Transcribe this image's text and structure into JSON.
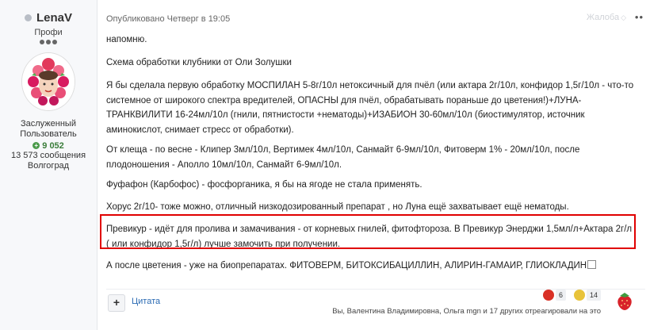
{
  "author": {
    "name": "LenaV",
    "rank": "Профи",
    "title": "Заслуженный Пользователь",
    "reputation": "9 052",
    "posts": "13 573 сообщения",
    "city": "Волгоград"
  },
  "post": {
    "published": "Опубликовано Четверг в 19:05",
    "share_label": "Жалоба",
    "share_count": "◇",
    "more": "••",
    "paragraphs": [
      "напомню.",
      "Схема обработки клубники от Оли Золушки",
      "Я бы сделала первую обработку МОСПИЛАН 5-8г/10л нетоксичный для пчёл (или актара 2г/10л, конфидор 1,5г/10л - что-то системное от широкого спектра вредителей, ОПАСНЫ для пчёл, обрабатывать пораньше до цветения!)+ЛУНА-ТРАНКВИЛИТИ 16-24мл/10л (гнили, пятнистости +нематоды)+ИЗАБИОН 30-60мл/10л (биостимулятор, источник аминокислот, снимает стресс от обработки).",
      "От клеща - по весне - Клипер 3мл/10л, Вертимек 4мл/10л, Санмайт 6-9мл/10л, Фитоверм 1% - 20мл/10л,  после плодоношения - Аполло 10мл/10л, Санмайт 6-9мл/10л.",
      "Фуфафон (Карбофос) - фосфорганика,  я бы на ягоде не стала применять.",
      "Хорус 2г/10- тоже можно, отличный низкодозированный препарат , но Луна ещё захватывает ещё нематоды.",
      "Превикур - идёт для пролива и замачивания - от корневых гнилей, фитофтороза. В Превикур Энерджи 1,5мл/л+Актара 2г/л ( или конфидор 1,5г/л) лучше замочить при получении.",
      "А после цветения - уже на биопрепаратах. ФИТОВЕРМ, БИТОКСИБАЦИЛЛИН, АЛИРИН-ГАМАИР, ГЛИОКЛАДИН"
    ]
  },
  "footer": {
    "add_label": "+",
    "quote_label": "Цитата",
    "reactions": [
      {
        "icon": "tomato-icon",
        "count": "6",
        "color": "#d93025"
      },
      {
        "icon": "bulb-icon",
        "count": "14",
        "color": "#e8c33a"
      }
    ],
    "reacted_text": "Вы, Валентина Владимировна, Ольга mgn и 17 других отреагировали на это"
  },
  "colors": {
    "highlight_border": "#e00000",
    "link": "#2a6ab3",
    "reputation": "#3a7d3a"
  }
}
